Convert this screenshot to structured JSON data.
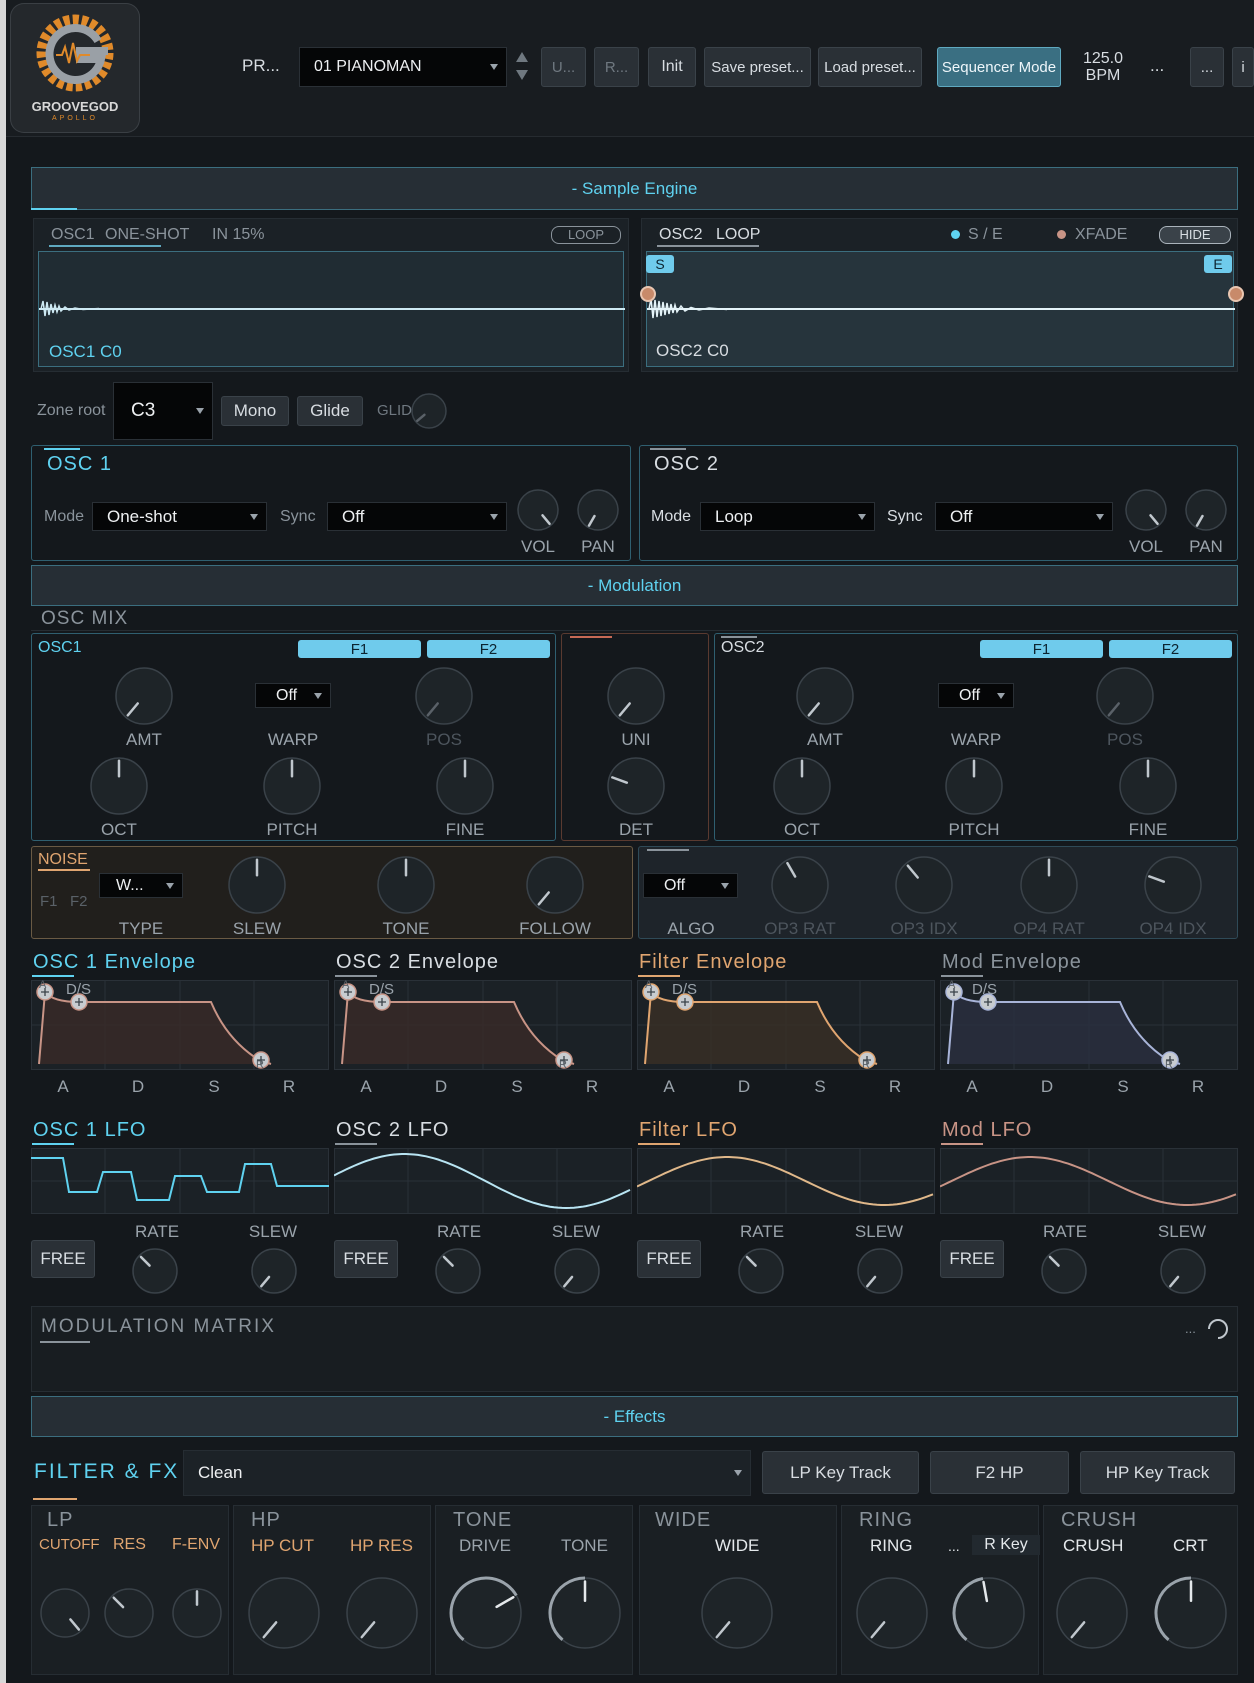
{
  "header": {
    "logo_text": "GROOVEGOD",
    "logo_sub": "APOLLO",
    "preset_label": "PR...",
    "preset_name": "01 PIANOMAN",
    "btn_u": "U...",
    "btn_r": "R...",
    "btn_init": "Init",
    "btn_save": "Save preset...",
    "btn_load": "Load preset...",
    "btn_seq": "Sequencer Mode",
    "bpm_value": "125.0",
    "bpm_unit": "BPM",
    "ellipsis1": "...",
    "ellipsis2": "...",
    "info": "i"
  },
  "sample_engine": {
    "bar_label": "- Sample Engine",
    "osc1": {
      "tab_name": "OSC1",
      "tab_mode": "ONE-SHOT",
      "tab_in": "IN 15%",
      "loop_btn": "LOOP",
      "wave_label": "OSC1 C0"
    },
    "osc2": {
      "tab_name": "OSC2",
      "tab_mode": "LOOP",
      "se_label": "S / E",
      "xfade_label": "XFADE",
      "hide_btn": "HIDE",
      "start_marker": "S",
      "end_marker": "E",
      "wave_label": "OSC2 C0"
    },
    "zone_root_label": "Zone root",
    "zone_root_value": "C3",
    "mono_btn": "Mono",
    "glide_btn": "Glide",
    "glide_label": "GLIDE"
  },
  "osc_panels": [
    {
      "title": "OSC 1",
      "mode_label": "Mode",
      "mode_value": "One-shot",
      "sync_label": "Sync",
      "sync_value": "Off",
      "vol": "VOL",
      "pan": "PAN"
    },
    {
      "title": "OSC 2",
      "mode_label": "Mode",
      "mode_value": "Loop",
      "sync_label": "Sync",
      "sync_value": "Off",
      "vol": "VOL",
      "pan": "PAN"
    }
  ],
  "modulation": {
    "bar_label": "- Modulation",
    "osc_mix_title": "OSC MIX",
    "osc1": {
      "name": "OSC1",
      "f1": "F1",
      "f2": "F2",
      "amt": "AMT",
      "warp": "WARP",
      "warp_value": "Off",
      "pos": "POS",
      "oct": "OCT",
      "pitch": "PITCH",
      "fine": "FINE"
    },
    "uni": {
      "uni": "UNI",
      "det": "DET"
    },
    "osc2": {
      "name": "OSC2",
      "f1": "F1",
      "f2": "F2",
      "amt": "AMT",
      "warp": "WARP",
      "warp_value": "Off",
      "pos": "POS",
      "oct": "OCT",
      "pitch": "PITCH",
      "fine": "FINE"
    },
    "noise": {
      "title": "NOISE",
      "f1": "F1",
      "f2": "F2",
      "type_value": "W...",
      "type": "TYPE",
      "slew": "SLEW",
      "tone": "TONE",
      "follow": "FOLLOW"
    },
    "fm": {
      "algo_value": "Off",
      "algo": "ALGO",
      "op3rat": "OP3 RAT",
      "op3idx": "OP3 IDX",
      "op4rat": "OP4 RAT",
      "op4idx": "OP4 IDX"
    }
  },
  "envelopes": [
    {
      "title": "OSC 1 Envelope",
      "ds": "D/S",
      "a_marker": "A",
      "r_marker": "R",
      "labels": [
        "A",
        "D",
        "S",
        "R"
      ]
    },
    {
      "title": "OSC 2 Envelope",
      "ds": "D/S",
      "a_marker": "A",
      "r_marker": "R",
      "labels": [
        "A",
        "D",
        "S",
        "R"
      ]
    },
    {
      "title": "Filter Envelope",
      "ds": "D/S",
      "a_marker": "A",
      "r_marker": "R",
      "labels": [
        "A",
        "D",
        "S",
        "R"
      ]
    },
    {
      "title": "Mod Envelope",
      "ds": "D/S",
      "a_marker": "A",
      "r_marker": "R",
      "labels": [
        "A",
        "D",
        "S",
        "R"
      ]
    }
  ],
  "lfos": [
    {
      "title": "OSC 1 LFO",
      "free": "FREE",
      "rate": "RATE",
      "slew": "SLEW"
    },
    {
      "title": "OSC 2 LFO",
      "free": "FREE",
      "rate": "RATE",
      "slew": "SLEW"
    },
    {
      "title": "Filter LFO",
      "free": "FREE",
      "rate": "RATE",
      "slew": "SLEW"
    },
    {
      "title": "Mod LFO",
      "free": "FREE",
      "rate": "RATE",
      "slew": "SLEW"
    }
  ],
  "mod_matrix": {
    "title": "MODULATION MATRIX",
    "ellipsis": "..."
  },
  "effects": {
    "bar_label": "- Effects",
    "title": "FILTER & FX",
    "mode_value": "Clean",
    "lp_key": "LP Key Track",
    "f2_hp": "F2 HP",
    "hp_key": "HP Key Track",
    "blocks": {
      "lp": {
        "title": "LP",
        "cutoff": "CUTOFF",
        "res": "RES",
        "fenv": "F-ENV"
      },
      "hp": {
        "title": "HP",
        "cut": "HP CUT",
        "res": "HP RES"
      },
      "tone": {
        "title": "TONE",
        "drive": "DRIVE",
        "tone": "TONE"
      },
      "wide": {
        "title": "WIDE",
        "wide": "WIDE"
      },
      "ring": {
        "title": "RING",
        "ring": "RING",
        "ellipsis": "...",
        "rkey": "R Key"
      },
      "crush": {
        "title": "CRUSH",
        "crush": "CRUSH",
        "crt": "CRT"
      }
    }
  },
  "colors": {
    "accent": "#5fd2f0",
    "filter": "#e0a570",
    "mod": "#a8b4d8",
    "env": "#c89486",
    "bg": "#14181c"
  }
}
